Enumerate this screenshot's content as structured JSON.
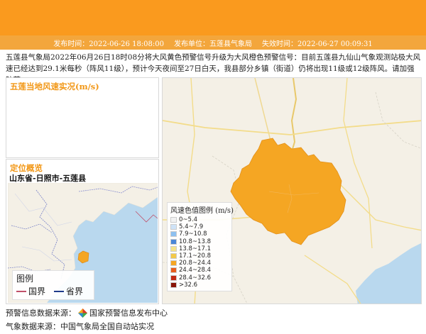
{
  "header": {
    "publish_time": "发布时间：2022-06-26 18:08:00",
    "publisher": "发布单位：五莲县气象局",
    "expire_time": "失效时间：2022-06-27 00:09:31"
  },
  "description": "五莲县气象局2022年06月26日18时08分将大风黄色预警信号升级为大风橙色预警信号：目前五莲县九仙山气象观测站极大风速已经达到29.1米每秒（阵风11级），预计今天夜间至27日白天，我县部分乡镇（街道）仍将出现11级或12级阵风。请加强防范。",
  "wind_panel": {
    "title": "五莲当地风速实况(m/s)"
  },
  "location_panel": {
    "title": "定位概览",
    "region": "山东省-日照市-五莲县",
    "legend": {
      "title": "图例",
      "items": [
        {
          "label": "国界",
          "color": "#c0506a"
        },
        {
          "label": "省界",
          "color": "#1e3a8a"
        }
      ]
    }
  },
  "wind_legend": {
    "title": "风速色值图例 (m/s)",
    "items": [
      {
        "label": "0~5.4",
        "color": "#f2f2f2"
      },
      {
        "label": "5.4~7.9",
        "color": "#cfe3f7"
      },
      {
        "label": "7.9~10.8",
        "color": "#8dc0f0"
      },
      {
        "label": "10.8~13.8",
        "color": "#4a86d8"
      },
      {
        "label": "13.8~17.1",
        "color": "#f5e38a"
      },
      {
        "label": "17.1~20.8",
        "color": "#f3c94a"
      },
      {
        "label": "20.8~24.4",
        "color": "#f5a623"
      },
      {
        "label": "24.4~28.4",
        "color": "#e85d1c"
      },
      {
        "label": "28.4~32.6",
        "color": "#c22a14"
      },
      {
        "label": ">32.6",
        "color": "#8a1508"
      }
    ]
  },
  "warning_color": "#f5a623",
  "sources": {
    "warning_label": "预警信息数据来源：",
    "warning_value": "国家预警信息发布中心",
    "weather_label": "气象数据来源：",
    "weather_value": "中国气象局全国自动站实况"
  }
}
